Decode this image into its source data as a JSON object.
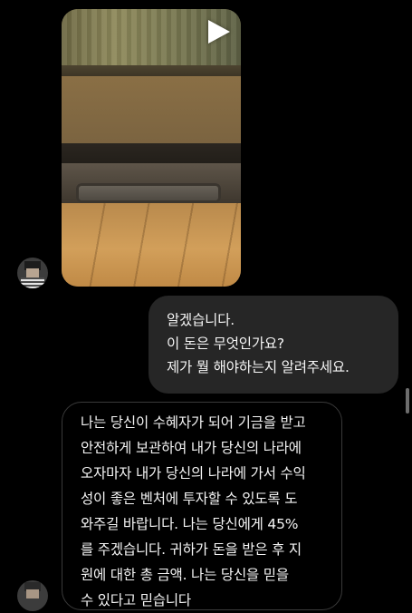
{
  "thread": {
    "video_message": {
      "play_icon": "play-icon",
      "content": "video-thumbnail"
    },
    "sent_message": {
      "lines": [
        "알겠습니다.",
        "이 돈은 무엇인가요?",
        "제가 뭘 해야하는지 알려주세요."
      ]
    },
    "received_message": {
      "lines": [
        "나는 당신이 수혜자가 되어 기금을 받고",
        "안전하게 보관하여 내가 당신의 나라에",
        "오자마자 내가 당신의 나라에 가서 수익",
        "성이 좋은 벤처에 투자할 수 있도록 도",
        "와주길 바랍니다. 나는 당신에게 45%",
        "를 주겠습니다.  귀하가 돈을 받은 후 지",
        "원에 대한 총 금액.  나는 당신을 믿을",
        "수 있다고 믿습니다"
      ]
    }
  },
  "colors": {
    "background": "#000000",
    "sent_bubble": "#262626",
    "received_bubble_border": "#3a3a3a",
    "text": "#f5f5f5"
  }
}
